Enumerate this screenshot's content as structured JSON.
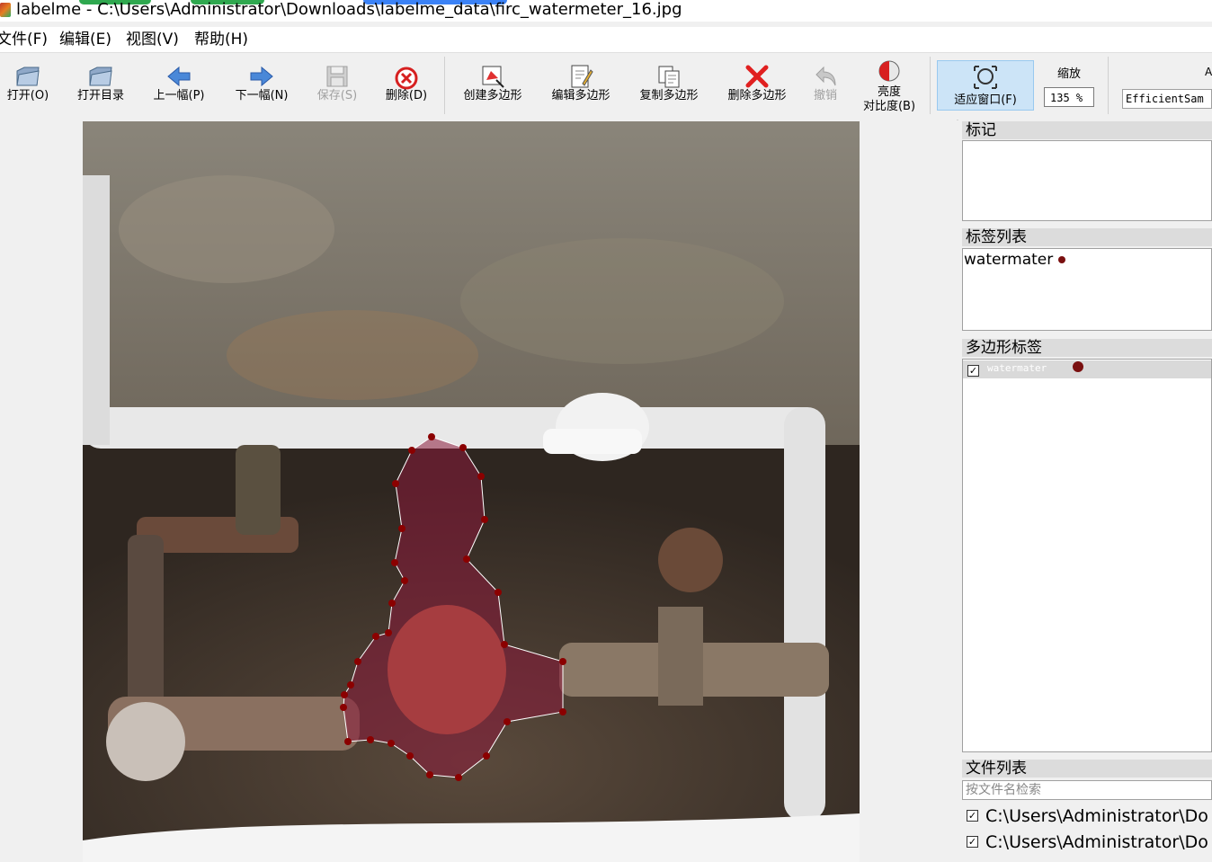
{
  "window": {
    "title": "labelme - C:\\Users\\Administrator\\Downloads\\labelme_data\\firc_watermeter_16.jpg"
  },
  "menu": {
    "items": [
      "文件(F)",
      "编辑(E)",
      "视图(V)",
      "帮助(H)"
    ]
  },
  "toolbar": {
    "open": "打开(O)",
    "open_dir": "打开目录",
    "prev": "上一幅(P)",
    "next": "下一幅(N)",
    "save": "保存(S)",
    "delete": "删除(D)",
    "create_polygon": "创建多边形",
    "edit_polygon": "编辑多边形",
    "duplicate_polygon": "复制多边形",
    "delete_polygon": "删除多边形",
    "undo": "撤销",
    "brightness_line1": "亮度",
    "brightness_line2": "对比度(B)",
    "fit_window": "适应窗口(F)",
    "zoom_label": "缩放",
    "zoom_value": "135 %",
    "model_label": "A",
    "model_value": "EfficientSam"
  },
  "dock": {
    "flags_title": "标记",
    "label_list_title": "标签列表",
    "label_list": [
      {
        "text": "watermater",
        "color": "#7a1010"
      }
    ],
    "polygon_labels_title": "多边形标签",
    "polygon_labels": [
      {
        "text": "watermater",
        "checked": true,
        "color": "#7a1010"
      }
    ],
    "file_list_title": "文件列表",
    "file_search_placeholder": "按文件名检索",
    "files": [
      {
        "path": "C:\\Users\\Administrator\\Do",
        "checked": true
      },
      {
        "path": "C:\\Users\\Administrator\\Do",
        "checked": true
      }
    ]
  },
  "colors": {
    "polygon_fill": "#8b1a3a",
    "polygon_vertex": "#8b0000",
    "accent_active": "#cce4f7"
  }
}
